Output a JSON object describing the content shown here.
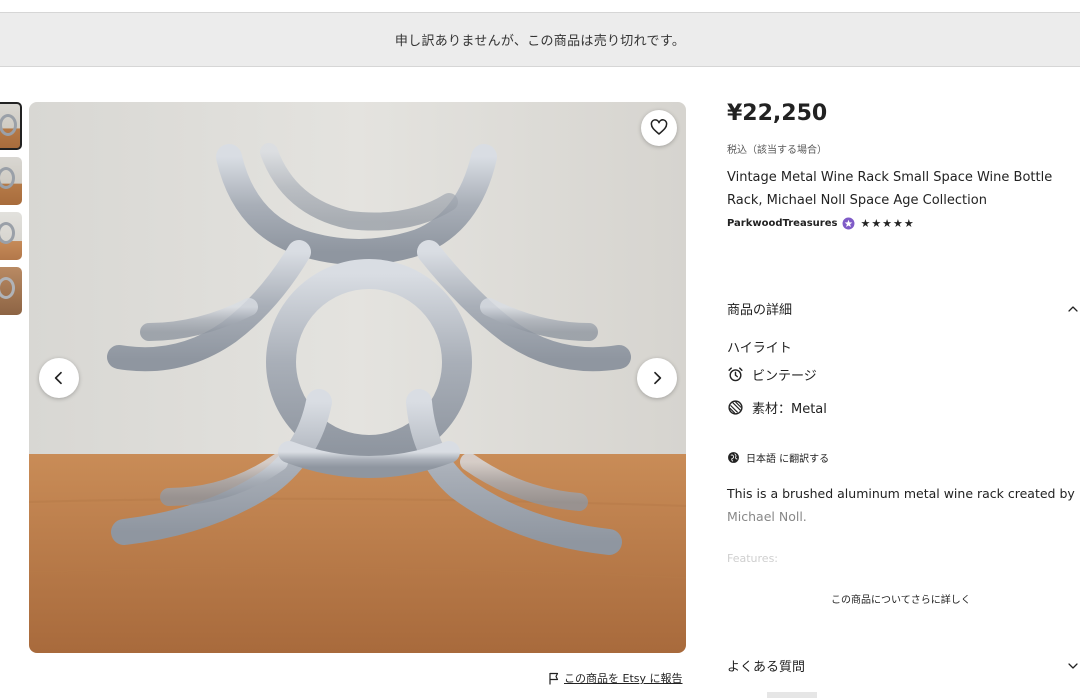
{
  "banner": {
    "sold_out_message": "申し訳ありませんが、この商品は売り切れです。"
  },
  "gallery": {
    "thumbnails": [
      "thumb-1",
      "thumb-2",
      "thumb-3",
      "thumb-4"
    ],
    "favorite_icon": "heart-icon",
    "prev_icon": "chevron-left-icon",
    "next_icon": "chevron-right-icon"
  },
  "report": {
    "icon": "flag-icon",
    "label": "この商品を Etsy に報告"
  },
  "product": {
    "price": "¥22,250",
    "tax_note": "税込（該当する場合）",
    "title": "Vintage Metal Wine Rack Small Space Wine Bottle Rack, Michael Noll Space Age Collection",
    "shop_name": "ParkwoodTreasures",
    "stars": "★★★★★"
  },
  "details": {
    "heading": "商品の詳細",
    "highlights_title": "ハイライト",
    "highlights": [
      {
        "icon": "alarm-clock-icon",
        "label": "ビンテージ"
      },
      {
        "icon": "material-icon",
        "label": "素材：Metal"
      }
    ],
    "translate_label": "日本語 に翻訳する",
    "description_line1": "This is a brushed aluminum metal wine rack created by",
    "description_line2": "Michael Noll.",
    "features_label": "Features:",
    "more_link": "この商品についてさらに詳しく"
  },
  "faq": {
    "heading": "よくある質問"
  },
  "colors": {
    "banner_bg": "#ececec",
    "text": "#222222",
    "star_badge": "#7f5bc7"
  }
}
